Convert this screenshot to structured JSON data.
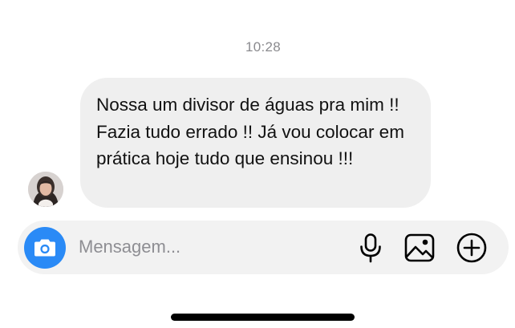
{
  "chat": {
    "timestamp": "10:28",
    "message": {
      "text": "Nossa um divisor de águas pra mim !! Fazia tudo errado !! Já vou colocar em prática hoje tudo que ensinou !!!"
    }
  },
  "composer": {
    "placeholder": "Mensagem..."
  },
  "icons": {
    "avatar": "profile-photo",
    "camera": "camera-icon",
    "mic": "microphone-icon",
    "gallery": "image-icon",
    "plus": "plus-circle-icon"
  },
  "colors": {
    "accent": "#2a8af6",
    "bubble": "#efefef",
    "composer": "#f2f2f2",
    "timestamp": "#8a8a8e"
  }
}
